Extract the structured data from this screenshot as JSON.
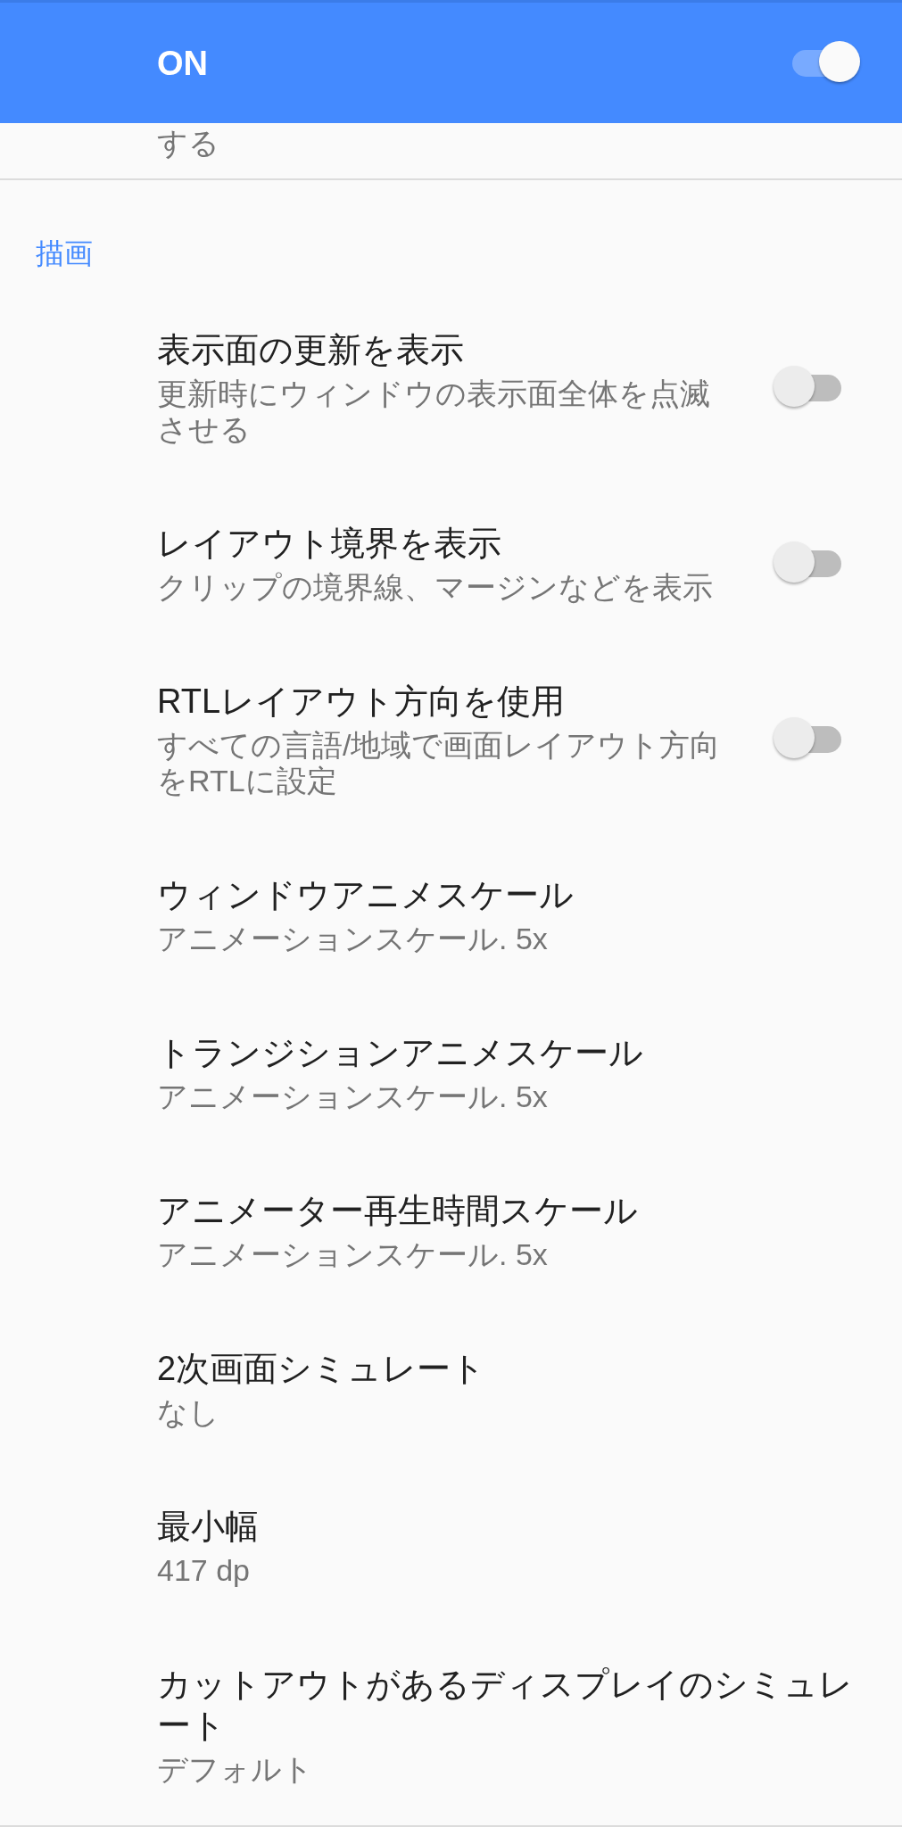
{
  "master_switch": {
    "label": "ON",
    "on": true
  },
  "previous_item": {
    "summary": "する"
  },
  "sections": [
    {
      "title": "描画",
      "items": [
        {
          "kind": "switch",
          "title": "表示面の更新を表示",
          "summary": "更新時にウィンドウの表示面全体を点滅させる",
          "on": false
        },
        {
          "kind": "switch",
          "title": "レイアウト境界を表示",
          "summary": "クリップの境界線、マージンなどを表示",
          "on": false
        },
        {
          "kind": "switch",
          "title": "RTLレイアウト方向を使用",
          "summary": "すべての言語/地域で画面レイアウト方向をRTLに設定",
          "on": false
        },
        {
          "kind": "value",
          "title": "ウィンドウアニメスケール",
          "summary": "アニメーションスケール. 5x"
        },
        {
          "kind": "value",
          "title": "トランジションアニメスケール",
          "summary": "アニメーションスケール. 5x"
        },
        {
          "kind": "value",
          "title": "アニメーター再生時間スケール",
          "summary": "アニメーションスケール. 5x"
        },
        {
          "kind": "value",
          "title": "2次画面シミュレート",
          "summary": "なし"
        },
        {
          "kind": "value",
          "title": "最小幅",
          "summary": "417 dp"
        },
        {
          "kind": "value",
          "title": "カットアウトがあるディスプレイのシミュレート",
          "summary": "デフォルト"
        }
      ]
    }
  ]
}
